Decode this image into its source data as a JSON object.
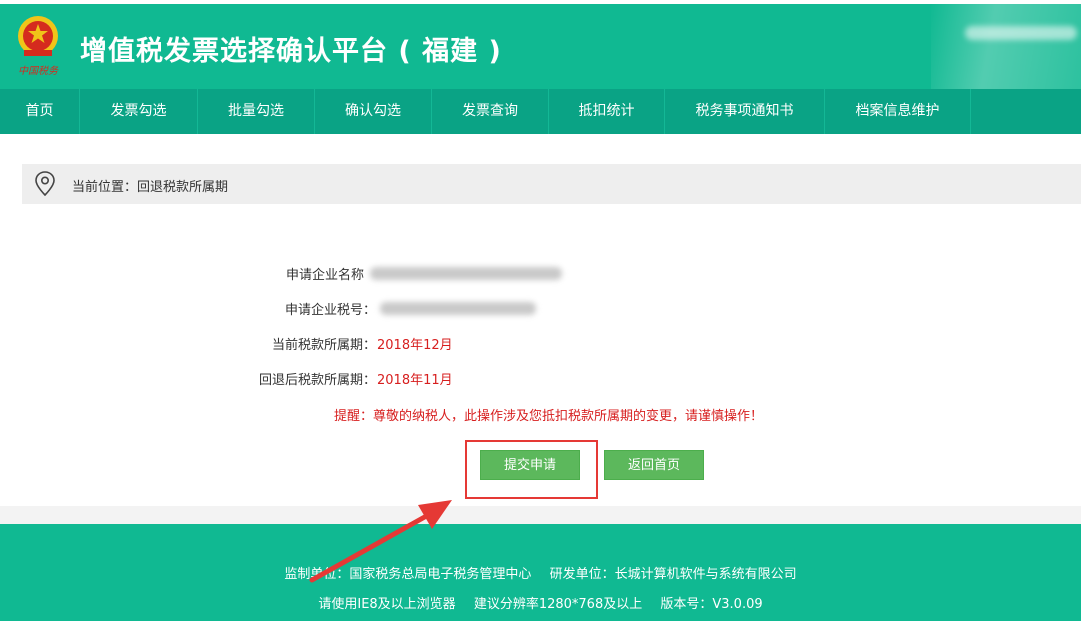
{
  "header": {
    "title": "增值税发票选择确认平台 ( 福建 )",
    "emblem_text": "中国税务"
  },
  "nav": {
    "items": [
      {
        "label": "首页"
      },
      {
        "label": "发票勾选"
      },
      {
        "label": "批量勾选"
      },
      {
        "label": "确认勾选"
      },
      {
        "label": "发票查询"
      },
      {
        "label": "抵扣统计"
      },
      {
        "label": "税务事项通知书"
      },
      {
        "label": "档案信息维护"
      }
    ]
  },
  "breadcrumb": {
    "text": "当前位置：回退税款所属期"
  },
  "form": {
    "company_name_label": "申请企业名称",
    "company_tax_label": "申请企业税号：",
    "current_period_label": "当前税款所属期：",
    "current_period_value": "2018年12月",
    "rollback_period_label": "回退后税款所属期：",
    "rollback_period_value": "2018年11月",
    "warning": "提醒：尊敬的纳税人，此操作涉及您抵扣税款所属期的变更，请谨慎操作！"
  },
  "buttons": {
    "submit": "提交申请",
    "back": "返回首页"
  },
  "footer": {
    "supervisor": "监制单位：国家税务总局电子税务管理中心",
    "developer": "研发单位：长城计算机软件与系统有限公司",
    "browser": "请使用IE8及以上浏览器",
    "resolution": "建议分辨率1280*768及以上",
    "version": "版本号：V3.0.09"
  },
  "colors": {
    "brand_green": "#10b992",
    "nav_green": "#0aa385",
    "button_green": "#5cb85c",
    "warning_red": "#d71f1f",
    "annotation_red": "#e53935"
  }
}
